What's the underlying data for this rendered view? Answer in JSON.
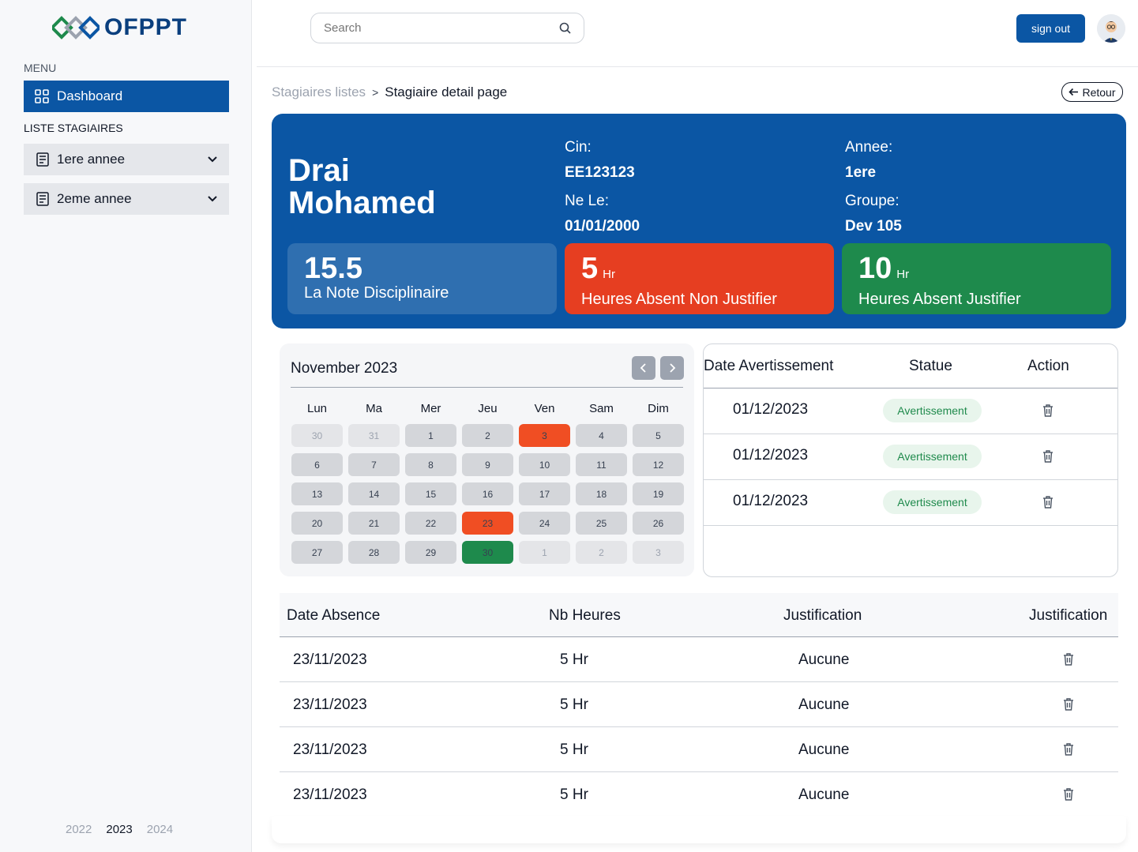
{
  "brand": {
    "name": "OFPPT",
    "primary_color": "#0b56a4"
  },
  "sidebar": {
    "menu_label": "MENU",
    "dashboard_label": "Dashboard",
    "liste_label": "LISTE STAGIAIRES",
    "items": [
      {
        "label": "1ere annee",
        "icon": "document-icon"
      },
      {
        "label": "2eme annee",
        "icon": "document-icon"
      }
    ],
    "years": [
      "2022",
      "2023",
      "2024"
    ],
    "active_year": "2023"
  },
  "header": {
    "search_placeholder": "Search",
    "signout_label": "sign out"
  },
  "breadcrumb": {
    "parent": "Stagiaires listes",
    "separator": ">",
    "current": "Stagiaire detail page"
  },
  "retour_label": "Retour",
  "student": {
    "first_line": "Drai",
    "second_line": "Mohamed",
    "cin_label": "Cin:",
    "cin": "EE123123",
    "ne_le_label": "Ne Le:",
    "ne_le": "01/01/2000",
    "annee_label": "Annee:",
    "annee": "1ere",
    "groupe_label": "Groupe:",
    "groupe": "Dev 105"
  },
  "stats": [
    {
      "value": "15.5",
      "unit": "",
      "label": "La Note Disciplinaire",
      "color": "#2f6fb0"
    },
    {
      "value": "5",
      "unit": "Hr",
      "label": "Heures Absent Non Justifier",
      "color": "#e63e21"
    },
    {
      "value": "10",
      "unit": "Hr",
      "label": "Heures Absent Justifier",
      "color": "#1e8a4c"
    }
  ],
  "calendar": {
    "title": "November 2023",
    "weekdays": [
      "Lun",
      "Ma",
      "Mer",
      "Jeu",
      "Ven",
      "Sam",
      "Dim"
    ],
    "days": [
      {
        "d": "30",
        "s": "muted"
      },
      {
        "d": "31",
        "s": "muted"
      },
      {
        "d": "1",
        "s": ""
      },
      {
        "d": "2",
        "s": ""
      },
      {
        "d": "3",
        "s": "red"
      },
      {
        "d": "4",
        "s": ""
      },
      {
        "d": "5",
        "s": ""
      },
      {
        "d": "6",
        "s": ""
      },
      {
        "d": "7",
        "s": ""
      },
      {
        "d": "8",
        "s": ""
      },
      {
        "d": "9",
        "s": ""
      },
      {
        "d": "10",
        "s": ""
      },
      {
        "d": "11",
        "s": ""
      },
      {
        "d": "12",
        "s": ""
      },
      {
        "d": "13",
        "s": ""
      },
      {
        "d": "14",
        "s": ""
      },
      {
        "d": "15",
        "s": ""
      },
      {
        "d": "16",
        "s": ""
      },
      {
        "d": "17",
        "s": ""
      },
      {
        "d": "18",
        "s": ""
      },
      {
        "d": "19",
        "s": ""
      },
      {
        "d": "20",
        "s": ""
      },
      {
        "d": "21",
        "s": ""
      },
      {
        "d": "22",
        "s": ""
      },
      {
        "d": "23",
        "s": "red"
      },
      {
        "d": "24",
        "s": ""
      },
      {
        "d": "25",
        "s": ""
      },
      {
        "d": "26",
        "s": ""
      },
      {
        "d": "27",
        "s": ""
      },
      {
        "d": "28",
        "s": ""
      },
      {
        "d": "29",
        "s": ""
      },
      {
        "d": "30",
        "s": "green"
      },
      {
        "d": "1",
        "s": "muted"
      },
      {
        "d": "2",
        "s": "muted"
      },
      {
        "d": "3",
        "s": "muted"
      }
    ]
  },
  "avertissements": {
    "headers": [
      "Date Avertissement",
      "Statue",
      "Action"
    ],
    "rows": [
      {
        "date": "01/12/2023",
        "status": "Avertissement"
      },
      {
        "date": "01/12/2023",
        "status": "Avertissement"
      },
      {
        "date": "01/12/2023",
        "status": "Avertissement"
      }
    ]
  },
  "absences": {
    "headers": [
      "Date Absence",
      "Nb Heures",
      "Justification",
      "Justification"
    ],
    "rows": [
      {
        "date": "23/11/2023",
        "hours": "5 Hr",
        "justification": "Aucune"
      },
      {
        "date": "23/11/2023",
        "hours": "5 Hr",
        "justification": "Aucune"
      },
      {
        "date": "23/11/2023",
        "hours": "5 Hr",
        "justification": "Aucune"
      },
      {
        "date": "23/11/2023",
        "hours": "5 Hr",
        "justification": "Aucune"
      }
    ]
  }
}
